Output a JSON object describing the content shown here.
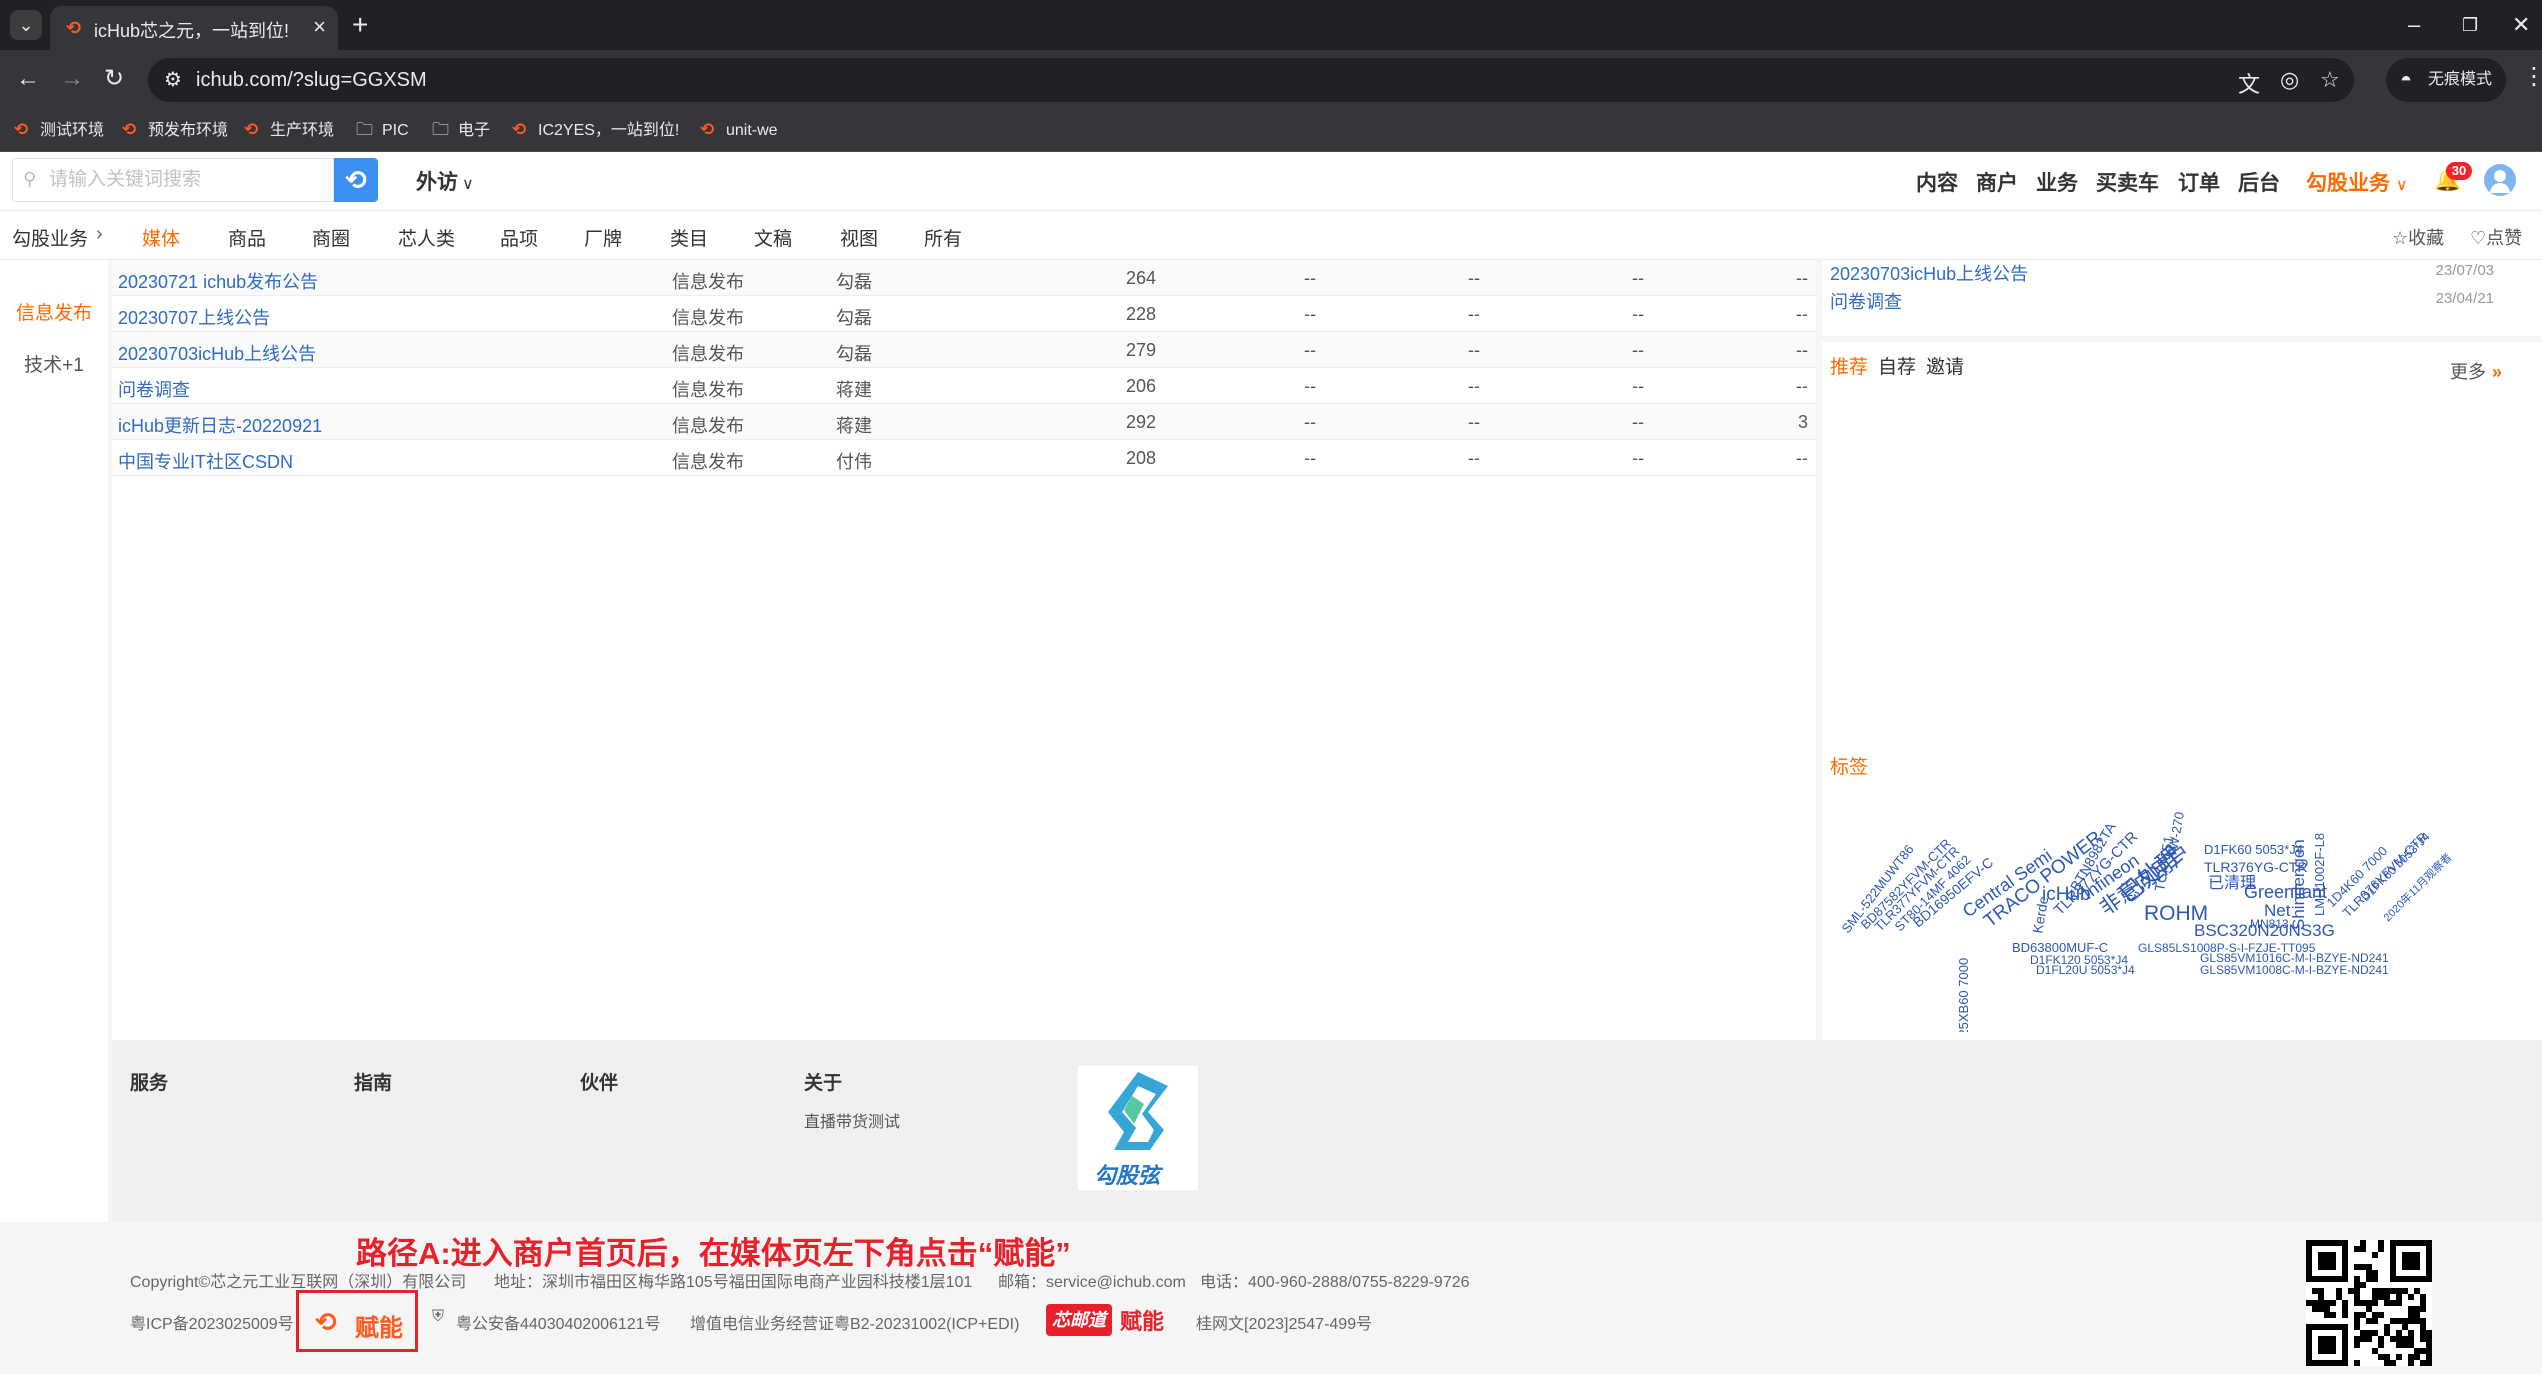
{
  "browser": {
    "tab_title": "icHub芯之元，一站到位!",
    "url": "ichub.com/?slug=GGXSM",
    "incognito_label": "无痕模式",
    "bookmarks": [
      "测试环境",
      "预发布环境",
      "生产环境",
      "PIC",
      "电子",
      "IC2YES，一站到位!",
      "unit-we"
    ]
  },
  "header": {
    "search_placeholder": "请输入关键词搜索",
    "visit_label": "外访",
    "nav": [
      "内容",
      "商户",
      "业务",
      "买卖车",
      "订单",
      "后台"
    ],
    "accent_nav": "勾股业务",
    "notification_count": "30"
  },
  "subnav": {
    "breadcrumb": "勾股业务",
    "tabs": [
      "媒体",
      "商品",
      "商圈",
      "芯人类",
      "品项",
      "厂牌",
      "类目",
      "文稿",
      "视图",
      "所有"
    ],
    "active_tab": "媒体",
    "favorite": "☆收藏",
    "like": "♡点赞"
  },
  "sidebar": {
    "items": [
      "信息发布",
      "技术+1"
    ]
  },
  "table": {
    "rows": [
      {
        "title": "20230721 ichub发布公告",
        "category": "信息发布",
        "author": "勾磊",
        "views": "264",
        "c1": "--",
        "c2": "--",
        "c3": "--",
        "c4": "--"
      },
      {
        "title": "20230707上线公告",
        "category": "信息发布",
        "author": "勾磊",
        "views": "228",
        "c1": "--",
        "c2": "--",
        "c3": "--",
        "c4": "--"
      },
      {
        "title": "20230703icHub上线公告",
        "category": "信息发布",
        "author": "勾磊",
        "views": "279",
        "c1": "--",
        "c2": "--",
        "c3": "--",
        "c4": "--"
      },
      {
        "title": "问卷调查",
        "category": "信息发布",
        "author": "蒋建",
        "views": "206",
        "c1": "--",
        "c2": "--",
        "c3": "--",
        "c4": "--"
      },
      {
        "title": "icHub更新日志-20220921",
        "category": "信息发布",
        "author": "蒋建",
        "views": "292",
        "c1": "--",
        "c2": "--",
        "c3": "--",
        "c4": "3"
      },
      {
        "title": "中国专业IT社区CSDN",
        "category": "信息发布",
        "author": "付伟",
        "views": "208",
        "c1": "--",
        "c2": "--",
        "c3": "--",
        "c4": "--"
      }
    ]
  },
  "right_panel": {
    "news": [
      {
        "title": "20230703icHub上线公告",
        "date": "23/07/03"
      },
      {
        "title": "问卷调查",
        "date": "23/04/21"
      }
    ],
    "rec_tabs": [
      "推荐",
      "自荐",
      "邀请"
    ],
    "more_label": "更多",
    "tag_title": "标签",
    "tags": [
      "SML-522MUWT86",
      "BD87582YFVM-CTR",
      "TLR377YFVM-CTR",
      "ST80-14MF 4062",
      "BD16950EFV-C",
      "Central Semi",
      "TRACO POWER",
      "icHub",
      "Kerde",
      "TLR377YG-CTR",
      "BTN8982TA",
      "Infineon",
      "非意向用户",
      "已处理",
      "TCK-151",
      "TW-270",
      "ROHM",
      "D1FK60 5053*J4",
      "TLR376YG-CTR",
      "已清理",
      "Greenliant",
      "Net",
      "MN813",
      "BSC320N20NS3G",
      "Shindengen",
      "LMH1002F-L8",
      "1D4K60 7000",
      "TLR376YFVM-CTR",
      "D1FK60 5053*J4",
      "2020年11月观察者",
      "D25XB60 7000",
      "BD63800MUF-C",
      "GLS85LS1008P-S-I-FZJE-TT095",
      "D1FK120 5053*J4",
      "GLS85VM1016C-M-I-BZYE-ND241",
      "D1FL20U 5053*J4",
      "GLS85VM1008C-M-I-BZYE-ND241"
    ]
  },
  "footer": {
    "columns": [
      "服务",
      "指南",
      "伙伴",
      "关于"
    ],
    "about_link": "直播带货测试",
    "logo_text": "勾股弦",
    "annotation": "路径A:进入商户首页后，在媒体页左下角点击“赋能”",
    "copyright": "Copyright©芯之元工业互联网（深圳）有限公司",
    "address": "地址：深圳市福田区梅华路105号福田国际电商产业园科技楼1层101",
    "email": "邮箱：service@ichub.com",
    "phone": "电话：400-960-2888/0755-8229-9726",
    "icp": "粤ICP备2023025009号",
    "fujin": "赋能",
    "police": "粤公安备44030402006121号",
    "license": "增值电信业务经营证粤B2-20231002(ICP+EDI)",
    "badge_text": "芯邮道",
    "fujin2": "赋能",
    "wenwang": "桂网文[2023]2547-499号"
  }
}
